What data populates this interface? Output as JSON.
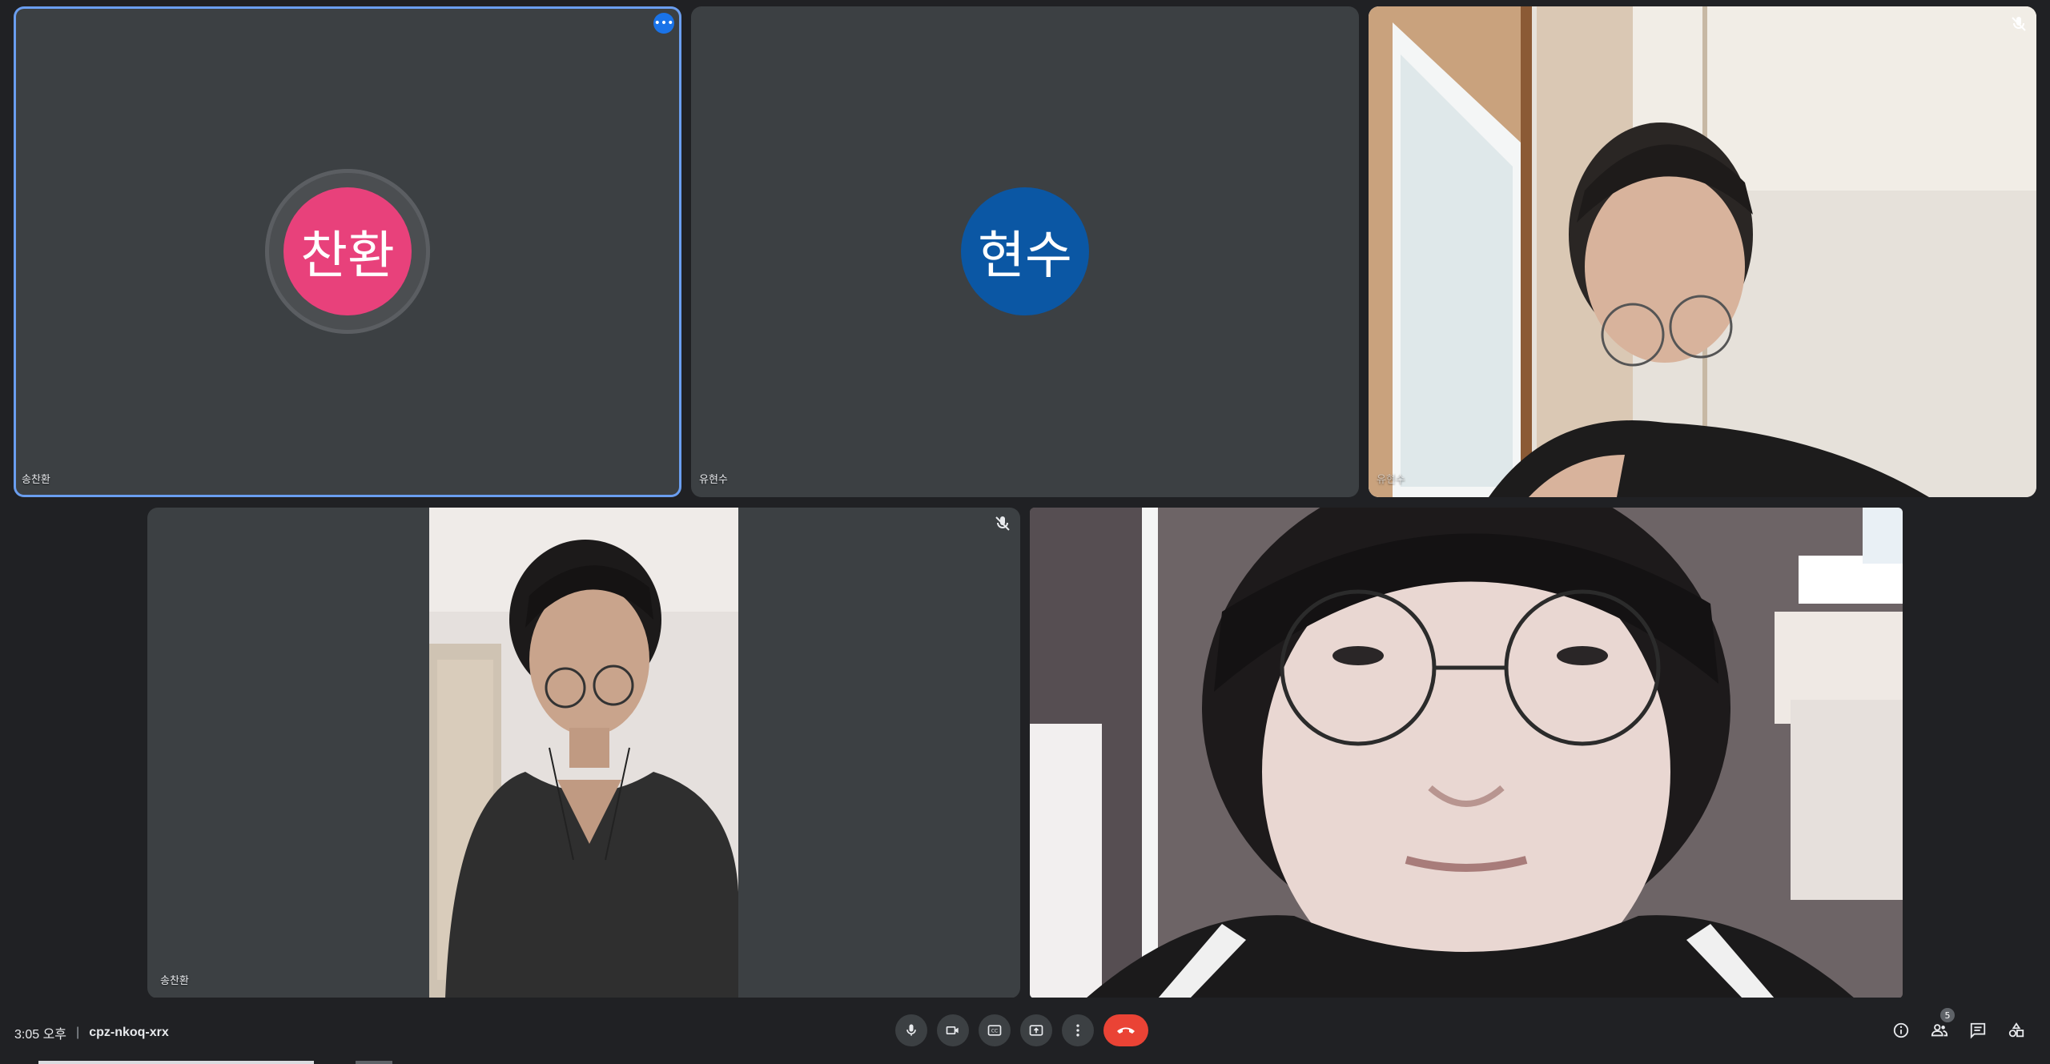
{
  "tiles": [
    {
      "name": "송찬환",
      "avatar_text": "찬환",
      "avatar_color": "#e8417b",
      "speaking": true,
      "pinned_menu": "more-options"
    },
    {
      "name": "유현수",
      "avatar_text": "현수",
      "avatar_color": "#0b57a4"
    },
    {
      "name": "유현수",
      "video": true,
      "muted": true
    },
    {
      "name": "송찬환",
      "video": true,
      "muted": true
    },
    {
      "name": "",
      "video": true
    }
  ],
  "footer": {
    "time": "3:05 오후",
    "separator": "|",
    "meeting_code": "cpz-nkoq-xrx",
    "participants_count": "5"
  },
  "controls": {
    "mic": "mic-icon",
    "camera": "camera-icon",
    "captions": "captions-icon",
    "present": "present-screen-icon",
    "more": "more-vert-icon",
    "end_call": "end-call-icon"
  },
  "colors": {
    "background": "#202124",
    "tile": "#3c4043",
    "accent": "#1a73e8",
    "end_call": "#ea4335"
  }
}
